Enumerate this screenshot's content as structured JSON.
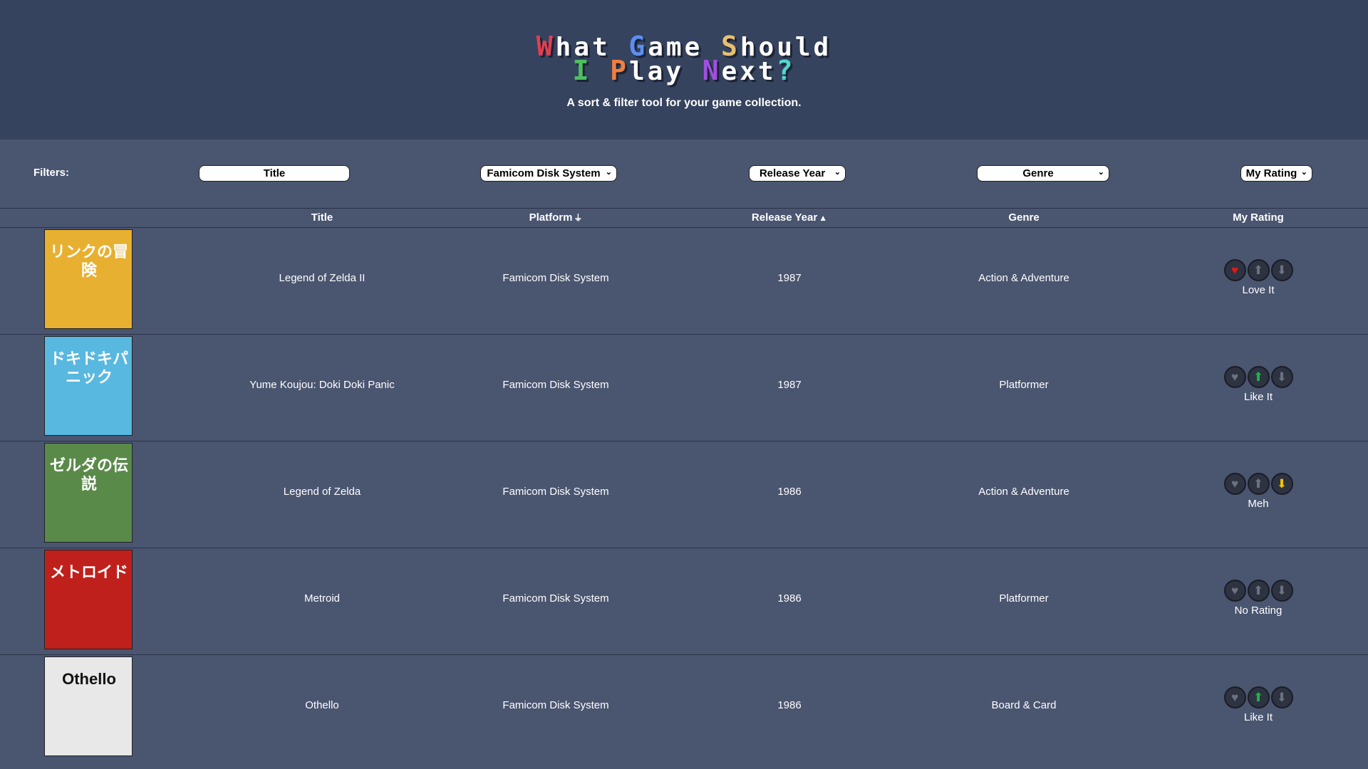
{
  "header": {
    "title_line1_caps": [
      "W",
      "G",
      "S"
    ],
    "title_line1_rest": [
      "hat ",
      "ame ",
      "hould"
    ],
    "title_line2_caps": [
      "I",
      "P",
      "N"
    ],
    "title_line2_rest": [
      " ",
      "lay ",
      "ext"
    ],
    "title_question": "?",
    "subtitle": "A sort & filter tool for your game collection."
  },
  "colors": {
    "header_bg": "#36435e",
    "page_bg": "#4a5570",
    "cap_red": "#e04050",
    "cap_blue": "#5b8ff0",
    "cap_yellow": "#e8c070",
    "cap_green": "#4cc060",
    "cap_orange": "#f08040",
    "cap_purple": "#a050e0",
    "cap_teal": "#50d8d0"
  },
  "filters": {
    "label": "Filters:",
    "title": "Title",
    "platform": "Famicom Disk System",
    "release_year": "Release Year",
    "genre": "Genre",
    "my_rating": "My Rating"
  },
  "table": {
    "headers": {
      "title": "Title",
      "platform": "Platform",
      "platform_sort": "⏚",
      "release_year": "Release Year",
      "release_year_sort": "▲",
      "genre": "Genre",
      "my_rating": "My Rating"
    },
    "rows": [
      {
        "cover_kana": "リンクの冒険",
        "cover_color": "#e8b030",
        "title": "Legend of Zelda II",
        "platform": "Famicom Disk System",
        "year": "1987",
        "genre": "Action & Adventure",
        "rating": "Love It",
        "active": "heart"
      },
      {
        "cover_kana": "ドキドキパニック",
        "cover_color": "#58b8e0",
        "title": "Yume Koujou: Doki Doki Panic",
        "platform": "Famicom Disk System",
        "year": "1987",
        "genre": "Platformer",
        "rating": "Like It",
        "active": "up"
      },
      {
        "cover_kana": "ゼルダの伝説",
        "cover_color": "#5a8a4a",
        "title": "Legend of Zelda",
        "platform": "Famicom Disk System",
        "year": "1986",
        "genre": "Action & Adventure",
        "rating": "Meh",
        "active": "down"
      },
      {
        "cover_kana": "メトロイド",
        "cover_color": "#c0201c",
        "title": "Metroid",
        "platform": "Famicom Disk System",
        "year": "1986",
        "genre": "Platformer",
        "rating": "No Rating",
        "active": "none"
      },
      {
        "cover_kana": "Othello",
        "cover_color": "#4a6a4a",
        "title": "Othello",
        "platform": "Famicom Disk System",
        "year": "1986",
        "genre": "Board & Card",
        "rating": "Like It",
        "active": "up"
      }
    ]
  },
  "icons": {
    "heart": "♥",
    "up": "⬆",
    "down": "⬇",
    "chevron": "⌄"
  }
}
